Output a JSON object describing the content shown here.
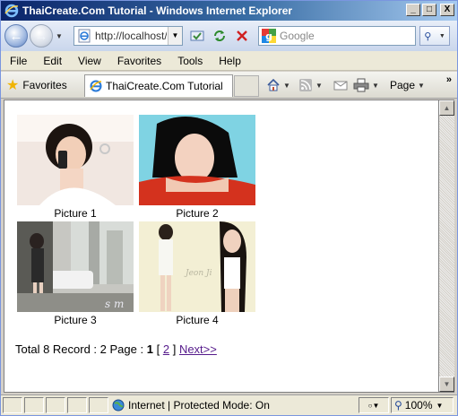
{
  "window": {
    "title": "ThaiCreate.Com Tutorial - Windows Internet Explorer",
    "controls": [
      "_",
      "□",
      "X"
    ]
  },
  "addressbar": {
    "url": "http://localhost/r",
    "search_placeholder": "Google"
  },
  "menu": {
    "items": [
      "File",
      "Edit",
      "View",
      "Favorites",
      "Tools",
      "Help"
    ]
  },
  "tabs": {
    "favorites_label": "Favorites",
    "active_tab_title": "ThaiCreate.Com Tutorial",
    "page_menu_label": "Page",
    "overflow": "»"
  },
  "gallery": {
    "items": [
      {
        "caption": "Picture 1"
      },
      {
        "caption": "Picture 2"
      },
      {
        "caption": "Picture 3"
      },
      {
        "caption": "Picture 4"
      }
    ]
  },
  "pager": {
    "summary": "Total 8 Record : 2 Page :",
    "current_page": "1",
    "open_bracket": "[",
    "page_link": "2",
    "close_bracket": "]",
    "next_label": "Next>>"
  },
  "status": {
    "zone_text": "Internet | Protected Mode: On",
    "zoom": "100%"
  },
  "colors": {
    "titlebar_start": "#0a246a",
    "link_visited": "#551a8b",
    "chrome": "#d4d0c8"
  }
}
